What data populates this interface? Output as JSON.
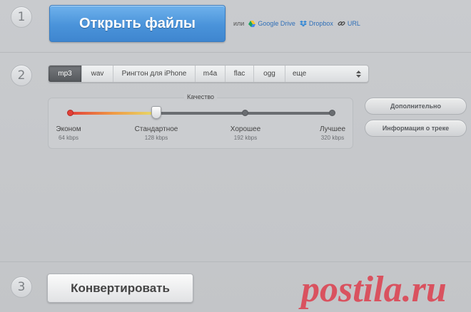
{
  "steps": {
    "one": "1",
    "two": "2",
    "three": "3"
  },
  "open_button": "Открыть файлы",
  "sources": {
    "or": "или",
    "google_drive": "Google Drive",
    "dropbox": "Dropbox",
    "url": "URL"
  },
  "formats": {
    "tabs": [
      "mp3",
      "wav",
      "Рингтон для iPhone",
      "m4a",
      "flac",
      "ogg"
    ],
    "more": "еще",
    "selected": "mp3"
  },
  "quality": {
    "title": "Качество",
    "selected_level": "Стандартное",
    "levels": [
      {
        "name": "Эконом",
        "rate": "64 kbps"
      },
      {
        "name": "Стандартное",
        "rate": "128 kbps"
      },
      {
        "name": "Хорошее",
        "rate": "192 kbps"
      },
      {
        "name": "Лучшее",
        "rate": "320 kbps"
      }
    ]
  },
  "side_buttons": {
    "advanced": "Дополнительно",
    "track_info": "Информация о треке"
  },
  "convert_button": "Конвертировать",
  "watermark": "postila.ru",
  "colors": {
    "primary_blue": "#4a93da",
    "link_blue": "#2f6fb8",
    "active_tab": "#5f6266",
    "watermark_red": "#d9525f"
  },
  "icons": {
    "google_drive": "google-drive-icon",
    "dropbox": "dropbox-icon",
    "url": "link-icon",
    "more": "up-down-arrows-icon"
  }
}
